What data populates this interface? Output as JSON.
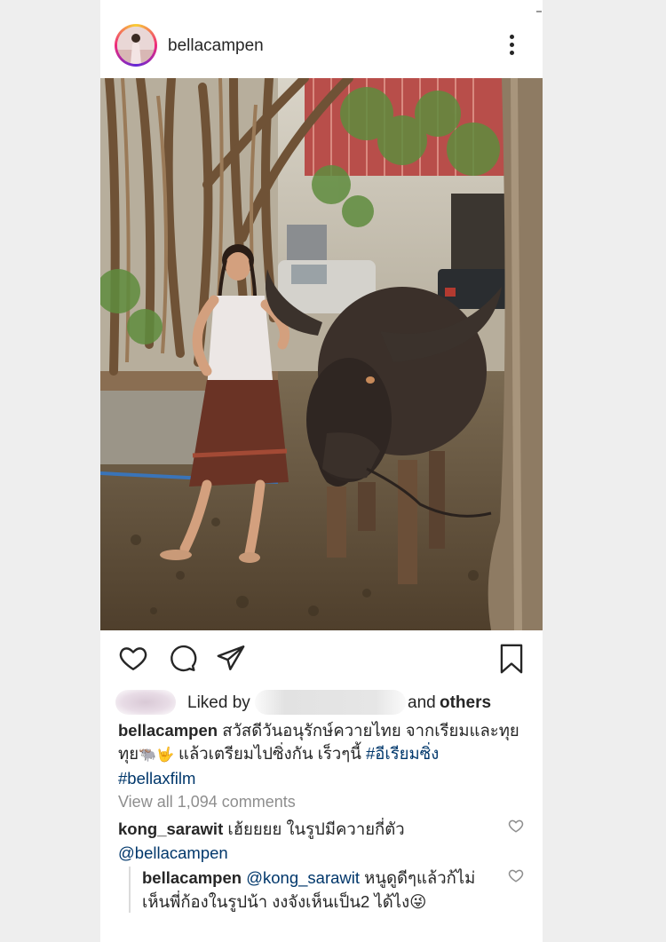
{
  "post": {
    "username": "bellacampen"
  },
  "icons": {
    "more": "more-options-icon",
    "like": "heart-icon",
    "comment": "comment-icon",
    "share": "paper-plane-icon",
    "save": "bookmark-icon"
  },
  "likes": {
    "liked_by_label": "Liked by",
    "and_label": "and",
    "others_label": "others"
  },
  "caption": {
    "username": "bellacampen",
    "text_part1": "สวัสดีวันอนุรักษ์ควายไทย จากเรียมและทุยทุย",
    "emoji": "🐃🤟",
    "text_part2": "แล้วเตรียมไปซิ่งกัน เร็วๆนี้",
    "hashtag1": "#อีเรียมซิ่ง",
    "hashtag2": "#bellaxfilm"
  },
  "view_all_comments": "View all 1,094 comments",
  "comments": [
    {
      "username": "kong_sarawit",
      "text": "เฮ้ยยยย ในรูปมีควายกี่ตัว",
      "mention": "@bellacampen"
    },
    {
      "username": "bellacampen",
      "mention": "@kong_sarawit",
      "text": "หนูดูดีๆแล้วก้ไม่เห็นพี่ก้องในรูปน้า งงจังเห็นเป็น2 ได้ไง",
      "emoji": "😜"
    }
  ],
  "colors": {
    "text": "#262626",
    "muted": "#8e8e8e",
    "hashtag": "#00376b",
    "background": "#eeeeee"
  }
}
